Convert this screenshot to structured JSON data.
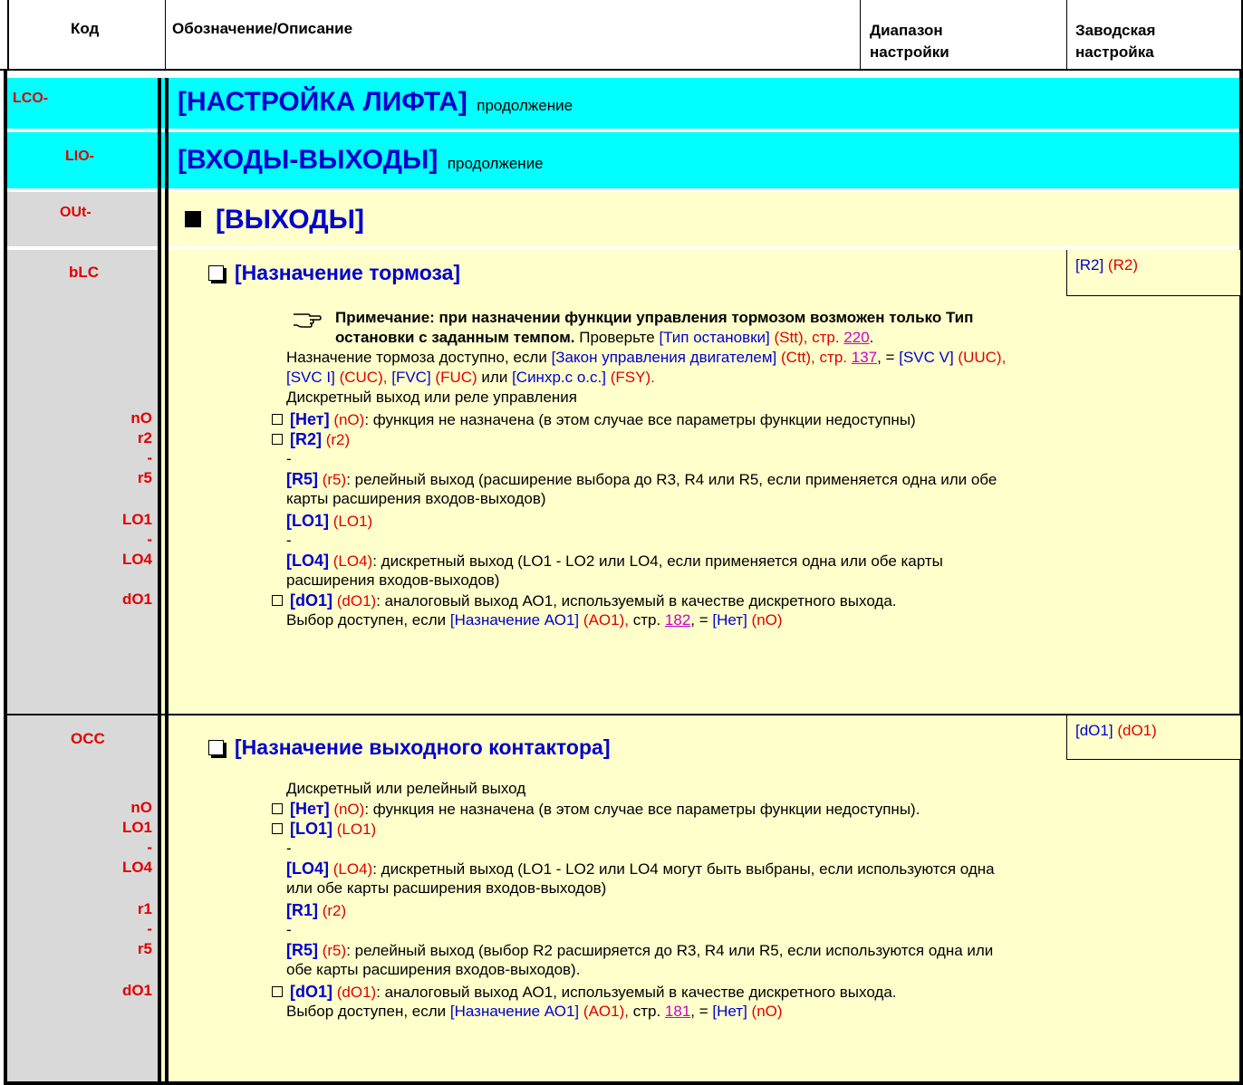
{
  "header": {
    "col_code": "Код",
    "col_desc": "Обозначение/Описание",
    "col_range": [
      "Диапазон",
      "настройки"
    ],
    "col_default": [
      "Заводская",
      "настройка"
    ]
  },
  "rows": {
    "lco": {
      "code": "LCO-",
      "title": "[НАСТРОЙКА ЛИФТА]",
      "suffix": "продолжение"
    },
    "lio": {
      "code": "LIO-",
      "title": "[ВХОДЫ-ВЫХОДЫ]",
      "suffix": "продолжение"
    },
    "out": {
      "code": "OUt-",
      "title": "[ВЫХОДЫ]"
    }
  },
  "blc": {
    "code": "bLC",
    "title": "[Назначение тормоза]",
    "default_label": "[R2]",
    "default_code": "(R2)",
    "note_bold_1": "Примечание: при назначении функции управления тормозом возможен только Тип",
    "note_bold_2": "остановки с заданным темпом.",
    "note_text": "Проверьте",
    "note_param": "[Тип остановки]",
    "note_param_code": "(Stt),",
    "note_page_prefix": "стр.",
    "note_page": "220",
    "avail_text": "Назначение тормоза доступно, если",
    "avail_param": "[Закон управления двигателем]",
    "avail_param_code": "(Ctt),",
    "avail_page_prefix": "стр.",
    "avail_page": "137",
    "avail_eq": ", =",
    "avail_v1": "[SVC V]",
    "avail_v1c": "(UUC),",
    "avail_v2": "[SVC I]",
    "avail_v2c": "(CUC),",
    "avail_v3": "[FVC]",
    "avail_v3c": "(FUC)",
    "avail_or": "или",
    "avail_v4": "[Синхр.с о.с.]",
    "avail_v4c": "(FSY).",
    "intro": "Дискретный выход или реле управления",
    "codes": [
      "nO",
      "r2",
      "-",
      "r5",
      "LO1",
      "-",
      "LO4",
      "dO1"
    ],
    "o_no": "[Нет]",
    "o_no_c": "(nO)",
    "o_no_t": ": функция не назначена (в этом случае все параметры функции недоступны)",
    "o_r2": "[R2]",
    "o_r2_c": "(r2)",
    "dash": "-",
    "o_r5": "[R5]",
    "o_r5_c": "(r5)",
    "o_r5_t": ": релейный выход (расширение выбора до R3, R4 или R5, если применяется одна или обе",
    "o_r5_t2": "карты расширения входов-выходов)",
    "o_lo1": "[LO1]",
    "o_lo1_c": "(LO1)",
    "o_lo4": "[LO4]",
    "o_lo4_c": "(LO4)",
    "o_lo4_t": ": дискретный выход (LO1 - LO2 или LO4, если применяется одна или обе карты",
    "o_lo4_t2": "расширения входов-выходов)",
    "o_do1": "[dO1]",
    "o_do1_c": "(dO1)",
    "o_do1_t": ": аналоговый выход АО1, используемый в качестве дискретного выхода.",
    "sel_text": "Выбор доступен, если",
    "sel_param": "[Назначение АО1]",
    "sel_code": "(AO1),",
    "sel_page_prefix": "стр.",
    "sel_page": "182",
    "sel_eq": ", =",
    "sel_val": "[Нет]",
    "sel_val_c": "(nO)"
  },
  "occ": {
    "code": "OCC",
    "title": "[Назначение выходного контактора]",
    "default_label": "[dO1]",
    "default_code": "(dO1)",
    "intro": "Дискретный или релейный выход",
    "codes": [
      "nO",
      "LO1",
      "-",
      "LO4",
      "r1",
      "-",
      "r5",
      "dO1"
    ],
    "o_no": "[Нет]",
    "o_no_c": "(nO)",
    "o_no_t": ": функция не назначена (в этом случае все параметры функции недоступны).",
    "o_lo1": "[LO1]",
    "o_lo1_c": "(LO1)",
    "dash": "-",
    "o_lo4": "[LO4]",
    "o_lo4_c": "(LO4)",
    "o_lo4_t": ": дискретный выход (LO1 - LO2 или LO4 могут быть выбраны, если  используются одна",
    "o_lo4_t2": "или обе карты расширения входов-выходов)",
    "o_r1": "[R1]",
    "o_r1_c": "(r2)",
    "o_r5": "[R5]",
    "o_r5_c": "(r5)",
    "o_r5_t": ": релейный выход (выбор R2 расширяется до R3, R4 или R5, если используются одна или",
    "o_r5_t2": "обе карты расширения входов-выходов).",
    "o_do1": "[dO1]",
    "o_do1_c": "(dO1)",
    "o_do1_t": ": аналоговый выход АО1, используемый в качестве дискретного выхода.",
    "sel_text": "Выбор доступен, если",
    "sel_param": "[Назначение АО1]",
    "sel_code": "(AO1),",
    "sel_page_prefix": "стр.",
    "sel_page": "181",
    "sel_eq": ", =",
    "sel_val": "[Нет]",
    "sel_val_c": "(nO)"
  }
}
